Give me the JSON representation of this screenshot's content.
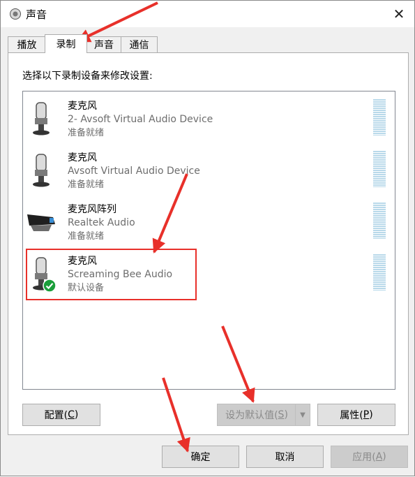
{
  "window": {
    "title": "声音",
    "close_glyph": "✕"
  },
  "tabs": [
    {
      "label": "播放",
      "active": false
    },
    {
      "label": "录制",
      "active": true
    },
    {
      "label": "声音",
      "active": false
    },
    {
      "label": "通信",
      "active": false
    }
  ],
  "instruction": "选择以下录制设备来修改设置:",
  "devices": [
    {
      "name": "麦克风",
      "desc": "2- Avsoft Virtual Audio Device",
      "status": "准备就绪",
      "icon": "microphone-icon",
      "default": false
    },
    {
      "name": "麦克风",
      "desc": "Avsoft Virtual Audio Device",
      "status": "准备就绪",
      "icon": "microphone-icon",
      "default": false
    },
    {
      "name": "麦克风阵列",
      "desc": "Realtek Audio",
      "status": "准备就绪",
      "icon": "microphone-array-icon",
      "default": false
    },
    {
      "name": "麦克风",
      "desc": "Screaming Bee Audio",
      "status": "默认设备",
      "icon": "microphone-icon",
      "default": true
    }
  ],
  "buttons": {
    "configure": {
      "text": "配置(",
      "key": "C",
      "end": ")"
    },
    "set_default": {
      "text": "设为默认值(",
      "key": "S",
      "end": ")"
    },
    "properties": {
      "text": "属性(",
      "key": "P",
      "end": ")"
    },
    "ok": "确定",
    "cancel": "取消",
    "apply": {
      "text": "应用(",
      "key": "A",
      "end": ")"
    }
  },
  "colors": {
    "annotation": "#e8302a",
    "meter": "#b9d9ea",
    "default_check": "#1a9e3a"
  }
}
